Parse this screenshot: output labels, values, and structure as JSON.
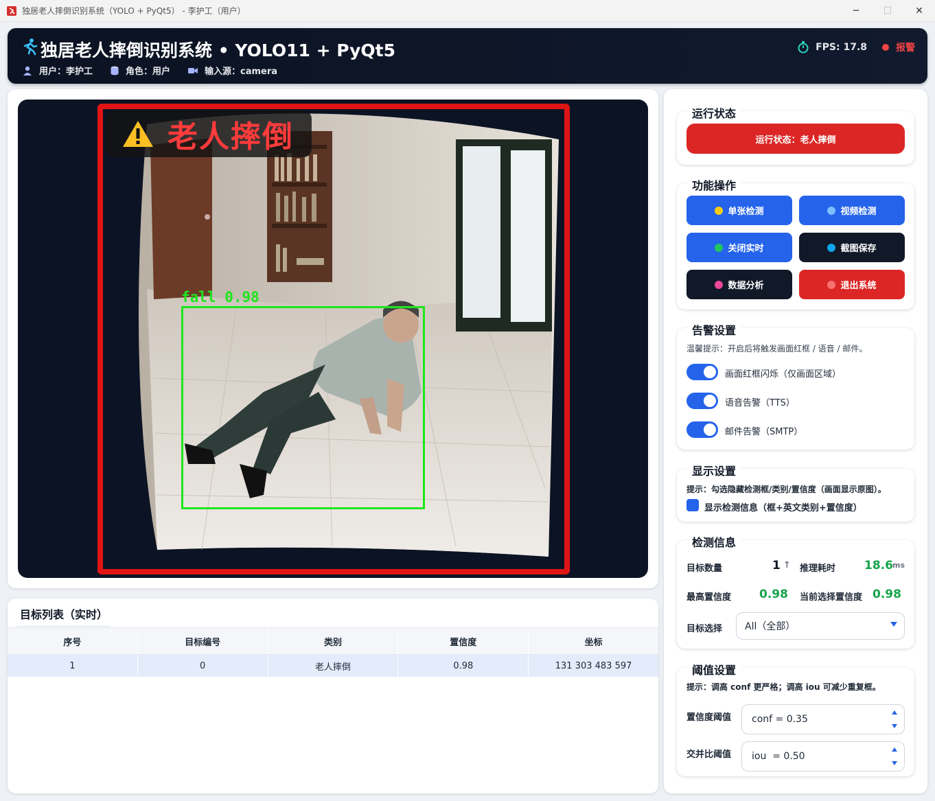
{
  "window": {
    "title": "独居老人摔倒识别系统（YOLO + PyQt5） - 李护工（用户）"
  },
  "header": {
    "title": "独居老人摔倒识别系统 • YOLO11 + PyQt5",
    "user_label": "用户：李护工",
    "role_label": "角色：用户",
    "source_label": "输入源：camera",
    "fps_label": "FPS: 17.8",
    "alarm_label": "报警"
  },
  "video": {
    "alert_text": "老人摔倒",
    "detection_label": "fall 0.98",
    "frame_color": "#e01414",
    "box_color": "#1ee61e"
  },
  "table": {
    "title": "目标列表（实时）",
    "columns": [
      "序号",
      "目标编号",
      "类别",
      "置信度",
      "坐标"
    ],
    "rows": [
      [
        "1",
        "0",
        "老人摔倒",
        "0.98",
        "131 303 483 597"
      ]
    ]
  },
  "status": {
    "legend": "运行状态",
    "button": "运行状态：老人摔倒"
  },
  "functions": {
    "legend": "功能操作",
    "buttons": [
      {
        "label": "单张检测",
        "dot": "#facc15"
      },
      {
        "label": "视频检测",
        "dot": "#7cc0ff"
      },
      {
        "label": "关闭实时",
        "dot": "#22c55e"
      },
      {
        "label": "截图保存",
        "dot": "#0ea5e9"
      },
      {
        "label": "数据分析",
        "dot": "#ec4899"
      },
      {
        "label": "退出系统",
        "dot": "#f87171"
      }
    ]
  },
  "alarm_settings": {
    "legend": "告警设置",
    "hint": "温馨提示：开启后将触发画面红框 / 语音 / 邮件。",
    "toggles": [
      "画面红框闪烁（仅画面区域）",
      "语音告警（TTS）",
      "邮件告警（SMTP）"
    ]
  },
  "display_settings": {
    "legend": "显示设置",
    "hint": "提示：勾选隐藏检测框/类别/置信度（画面显示原图）。",
    "checkbox": "显示检测信息（框+英文类别+置信度）"
  },
  "detection_info": {
    "legend": "检测信息",
    "count_label": "目标数量",
    "count_value": "1",
    "count_arrow": "↑",
    "time_label": "推理耗时",
    "time_value": "18.6",
    "time_unit": "ms",
    "maxconf_label": "最高置信度",
    "maxconf_value": "0.98",
    "selconf_label": "当前选择置信度",
    "selconf_value": "0.98",
    "select_label": "目标选择",
    "select_value": "All（全部）"
  },
  "threshold": {
    "legend": "阈值设置",
    "hint": "提示：调高 conf 更严格；调高 iou 可减少重复框。",
    "conf_label": "置信度阈值",
    "conf_value": "conf = 0.35",
    "iou_label": "交并比阈值",
    "iou_value": "iou  = 0.50"
  }
}
